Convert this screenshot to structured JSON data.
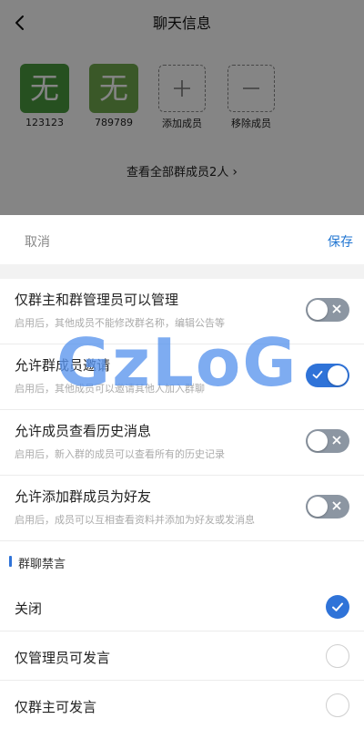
{
  "header": {
    "title": "聊天信息",
    "back_icon": "back-arrow-icon"
  },
  "members": [
    {
      "avatar_text": "无",
      "name": "123123",
      "color": "#4a9a3f"
    },
    {
      "avatar_text": "无",
      "name": "789789",
      "color": "#6faa4e"
    }
  ],
  "member_actions": {
    "add_label": "添加成员",
    "remove_label": "移除成员"
  },
  "view_all": {
    "label": "查看全部群成员2人",
    "icon": "chevron-right-icon"
  },
  "sheet": {
    "cancel_label": "取消",
    "save_label": "保存"
  },
  "settings": [
    {
      "title": "仅群主和群管理员可以管理",
      "desc": "启用后，其他成员不能修改群名称，编辑公告等",
      "enabled": false
    },
    {
      "title": "允许群成员邀请",
      "desc": "启用后，其他成员可以邀请其他人加入群聊",
      "enabled": true
    },
    {
      "title": "允许成员查看历史消息",
      "desc": "启用后，新入群的成员可以查看所有的历史记录",
      "enabled": false
    },
    {
      "title": "允许添加群成员为好友",
      "desc": "启用后，成员可以互相查看资料并添加为好友或发消息",
      "enabled": false
    }
  ],
  "mute": {
    "section_title": "群聊禁言",
    "options": [
      {
        "label": "关闭",
        "selected": true
      },
      {
        "label": "仅管理员可发言",
        "selected": false
      },
      {
        "label": "仅群主可发言",
        "selected": false
      }
    ]
  },
  "watermark": "GzLoG",
  "colors": {
    "accent": "#2f73d8",
    "save": "#2176d2",
    "toggle_off": "#8c96a2"
  }
}
